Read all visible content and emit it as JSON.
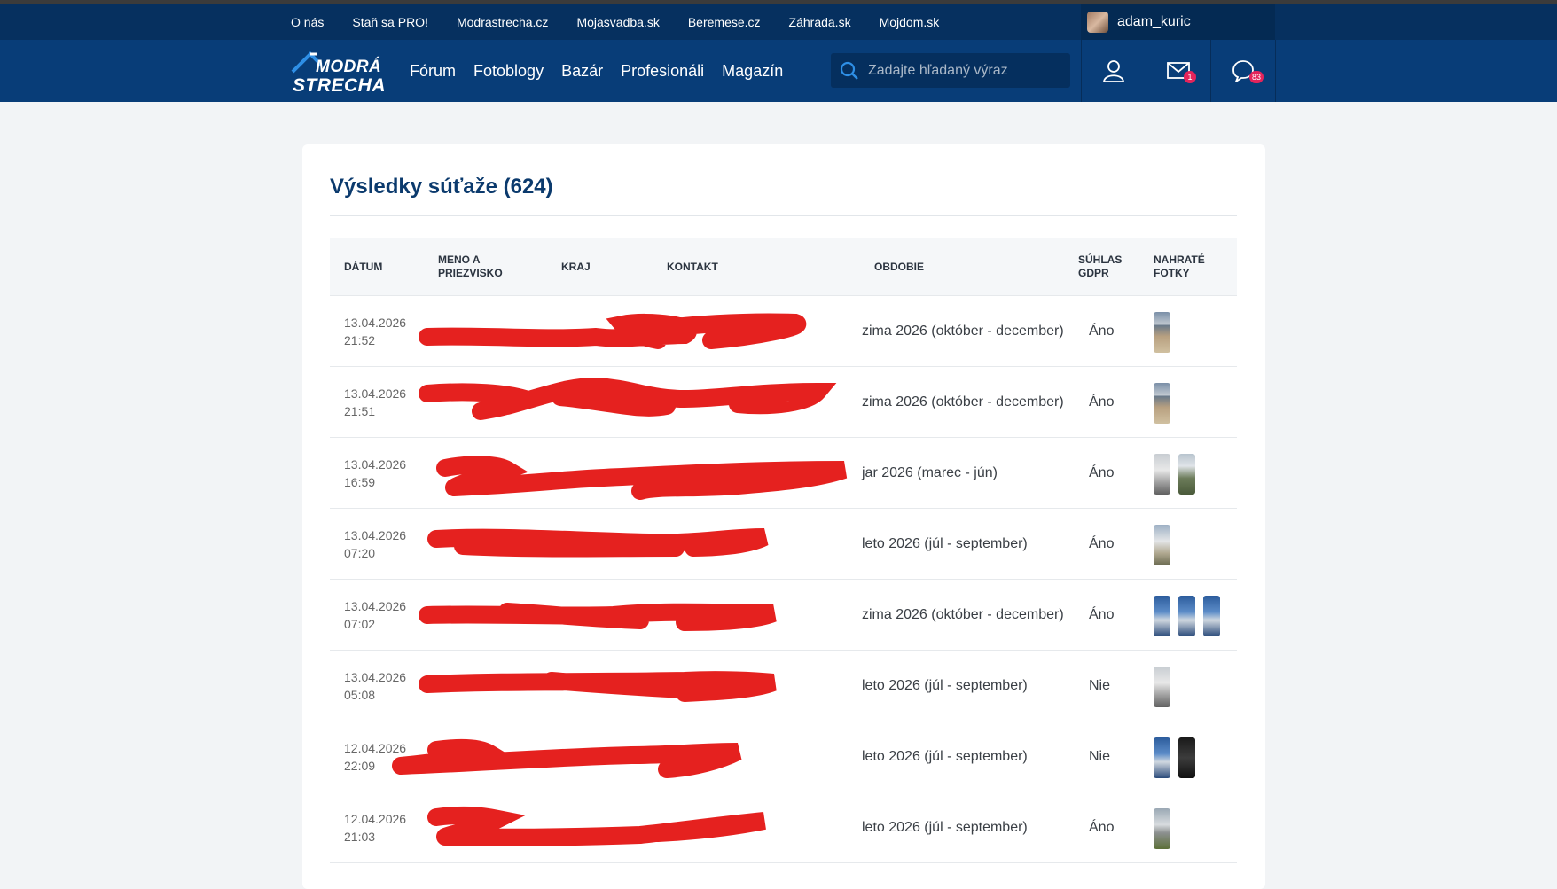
{
  "topbar": {
    "links": [
      "O nás",
      "Staň sa PRO!",
      "Modrastrecha.cz",
      "Mojasvadba.sk",
      "Beremese.cz",
      "Záhrada.sk",
      "Mojdom.sk"
    ],
    "username": "adam_kuric"
  },
  "mainbar": {
    "logo_line1": "MODRÁ",
    "logo_line2": "STRECHA",
    "nav": [
      "Fórum",
      "Fotoblogy",
      "Bazár",
      "Profesionáli",
      "Magazín"
    ],
    "search_placeholder": "Zadajte hľadaný výraz",
    "messages_badge": "1",
    "notifications_badge": "83"
  },
  "page": {
    "title": "Výsledky súťaže (624)",
    "columns": {
      "datum": "DÁTUM",
      "meno": "MENO A PRIEZVISKO",
      "kraj": "KRAJ",
      "kontakt": "KONTAKT",
      "obdobie": "OBDOBIE",
      "suhlas": "SÚHLAS GDPR",
      "fotky": "NAHRATÉ FOTKY"
    },
    "rows": [
      {
        "date": "13.04.2026",
        "time": "21:52",
        "obdobie": "zima 2026 (október - december)",
        "gdpr": "Áno",
        "photos": [
          "t1"
        ]
      },
      {
        "date": "13.04.2026",
        "time": "21:51",
        "obdobie": "zima 2026 (október - december)",
        "gdpr": "Áno",
        "photos": [
          "t1"
        ]
      },
      {
        "date": "13.04.2026",
        "time": "16:59",
        "obdobie": "jar 2026 (marec - jún)",
        "gdpr": "Áno",
        "photos": [
          "t5",
          "t3"
        ]
      },
      {
        "date": "13.04.2026",
        "time": "07:20",
        "obdobie": "leto 2026 (júl - september)",
        "gdpr": "Áno",
        "photos": [
          "t7"
        ]
      },
      {
        "date": "13.04.2026",
        "time": "07:02",
        "obdobie": "zima 2026 (október - december)",
        "gdpr": "Áno",
        "photos": [
          "t4",
          "t4",
          "t4"
        ]
      },
      {
        "date": "13.04.2026",
        "time": "05:08",
        "obdobie": "leto 2026 (júl - september)",
        "gdpr": "Nie",
        "photos": [
          "t5"
        ]
      },
      {
        "date": "12.04.2026",
        "time": "22:09",
        "obdobie": "leto 2026 (júl - september)",
        "gdpr": "Nie",
        "photos": [
          "t4",
          "t6"
        ]
      },
      {
        "date": "12.04.2026",
        "time": "21:03",
        "obdobie": "leto 2026 (júl - september)",
        "gdpr": "Áno",
        "photos": [
          "t2"
        ]
      }
    ]
  }
}
